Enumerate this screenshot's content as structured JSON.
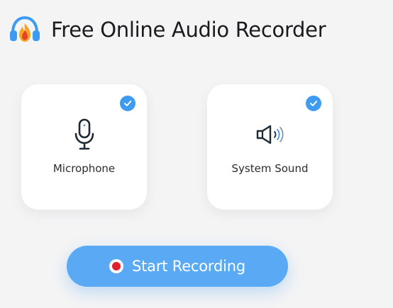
{
  "header": {
    "title": "Free Online Audio Recorder",
    "logo_icon": "headphones-flame-logo"
  },
  "sources": [
    {
      "label": "Microphone",
      "icon": "microphone-icon",
      "selected": true
    },
    {
      "label": "System Sound",
      "icon": "speaker-icon",
      "selected": true
    }
  ],
  "action": {
    "start_label": "Start Recording",
    "icon": "record-icon"
  },
  "colors": {
    "accent": "#3d9bf2",
    "button": "#59a9f4",
    "record": "#e1202c",
    "background": "#f4f4f5"
  }
}
